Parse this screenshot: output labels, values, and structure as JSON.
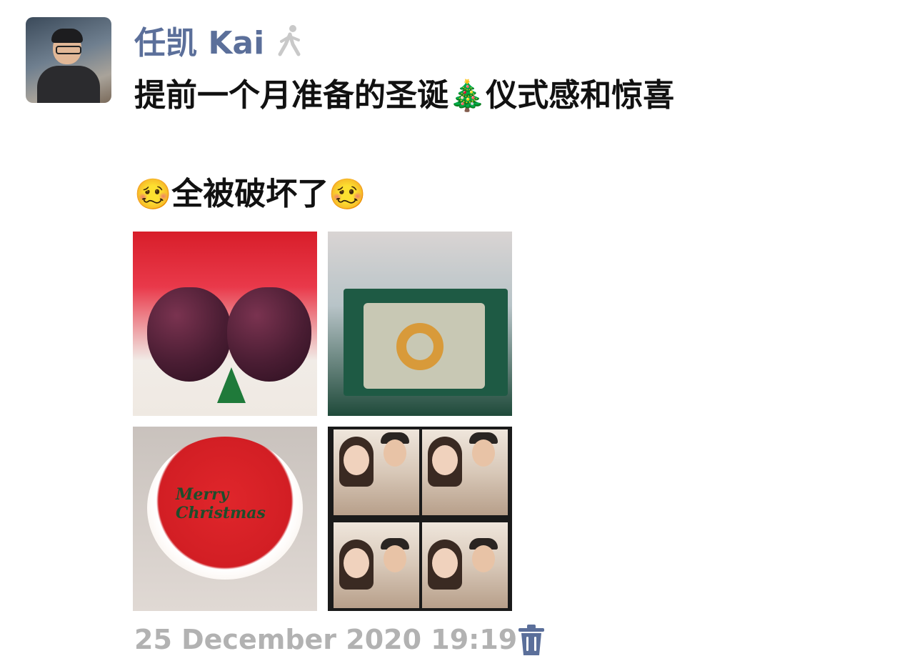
{
  "post": {
    "author_name": "任凯 Kai",
    "text_line1": "提前一个月准备的圣诞",
    "text_line1_emoji": "🎄",
    "text_line1_tail": "仪式感和惊喜",
    "text_line2_emoji_left": "🥴",
    "text_line2": "全被破坏了",
    "text_line2_emoji_right": "🥴",
    "timestamp": "25 December 2020 19:19"
  },
  "photos": [
    {
      "subject": "two red apples with Merry Christmas"
    },
    {
      "subject": "christmas gift box"
    },
    {
      "subject": "Merry Christmas cake",
      "caption": "Merry Christmas"
    },
    {
      "subject": "photo booth strip of couple"
    }
  ],
  "colors": {
    "author_name": "#5b6f9a",
    "timestamp": "#b2b2b2",
    "trash_icon": "#5b6f9a"
  },
  "icons": {
    "status": "walking-person-icon",
    "delete": "trash-icon"
  }
}
